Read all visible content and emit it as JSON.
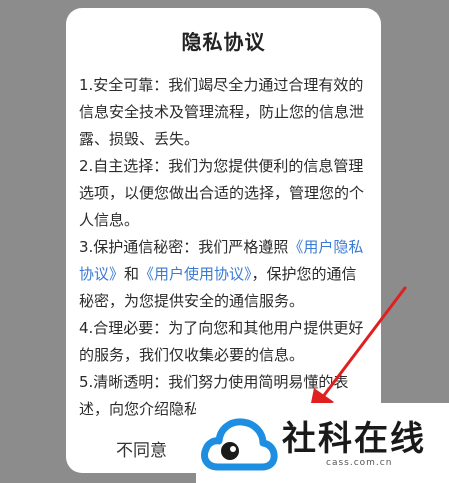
{
  "dialog": {
    "title": "隐私协议",
    "sections": [
      {
        "text": "1.安全可靠：我们竭尽全力通过合理有效的信息安全技术及管理流程，防止您的信息泄露、损毁、丢失。"
      },
      {
        "text": "2.自主选择：我们为您提供便利的信息管理选项，以便您做出合适的选择，管理您的个人信息。"
      },
      {
        "prefix": "3.保护通信秘密：我们严格遵照",
        "link1": "《用户隐私协议》",
        "mid": "和",
        "link2": "《用户使用协议》",
        "suffix": "，保护您的通信秘密，为您提供安全的通信服务。"
      },
      {
        "text": "4.合理必要：为了向您和其他用户提供更好的服务，我们仅收集必要的信息。"
      },
      {
        "text": "5.清晰透明：我们努力使用简明易懂的表述，向您介绍隐私"
      }
    ],
    "disagree_label": "不同意",
    "agree_label": ""
  },
  "watermark": {
    "text": "社科在线",
    "subtext": "cass.com.cn"
  },
  "colors": {
    "overlay": "#8c8c8c",
    "link": "#3a7bd5",
    "arrow": "#e02020",
    "logo_blue": "#1e8fe0"
  }
}
